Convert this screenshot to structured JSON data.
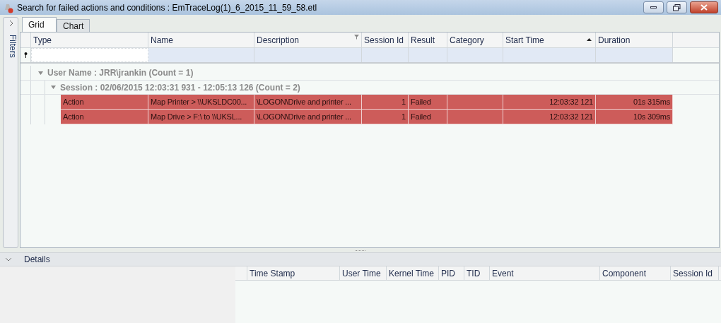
{
  "window": {
    "title": "Search for failed actions and conditions : EmTraceLog(1)_6_2015_11_59_58.etl"
  },
  "filters_panel": {
    "label": "Filters",
    "expanded": false
  },
  "tabs": [
    {
      "label": "Grid",
      "selected": true
    },
    {
      "label": "Chart",
      "selected": false
    }
  ],
  "grid": {
    "columns": [
      {
        "label": "Type",
        "filtered": false,
        "sorted": false
      },
      {
        "label": "Name",
        "filtered": false,
        "sorted": false
      },
      {
        "label": "Description",
        "filtered": true,
        "sorted": false
      },
      {
        "label": "Session Id",
        "filtered": false,
        "sorted": false
      },
      {
        "label": "Result",
        "filtered": false,
        "sorted": false
      },
      {
        "label": "Category",
        "filtered": false,
        "sorted": false
      },
      {
        "label": "Start Time",
        "filtered": false,
        "sorted": true
      },
      {
        "label": "Duration",
        "filtered": false,
        "sorted": false
      }
    ],
    "groups": [
      {
        "label": "User Name : JRR\\jrankin (Count = 1)",
        "expanded": true,
        "children": [
          {
            "label": "Session : 02/06/2015 12:03:31 931 - 12:05:13 126 (Count = 2)",
            "expanded": true,
            "rows": [
              {
                "failed": true,
                "cells": [
                  "Action",
                  "Map Printer > \\\\UKSLDC00...",
                  "\\LOGON\\Drive and printer ...",
                  "1",
                  "Failed",
                  "",
                  "12:03:32 121",
                  "01s 315ms"
                ]
              },
              {
                "failed": true,
                "cells": [
                  "Action",
                  "Map Drive > F:\\ to \\\\UKSL...",
                  "\\LOGON\\Drive and printer ...",
                  "1",
                  "Failed",
                  "",
                  "12:03:32 121",
                  "10s 309ms"
                ]
              }
            ]
          }
        ]
      }
    ]
  },
  "details": {
    "title": "Details",
    "expanded": true,
    "columns": [
      "Time Stamp",
      "User Time",
      "Kernel Time",
      "PID",
      "TID",
      "Event",
      "Component",
      "Session Id"
    ]
  }
}
